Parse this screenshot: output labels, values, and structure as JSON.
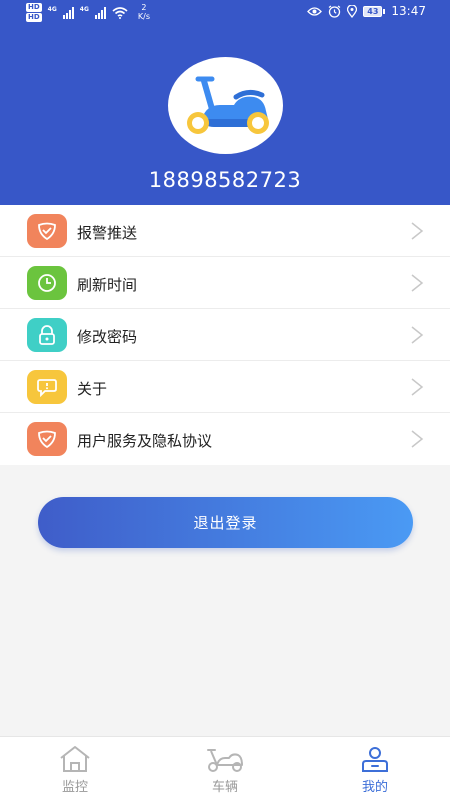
{
  "status_bar": {
    "hd1": "HD",
    "hd2": "HD",
    "net1": "4G",
    "net2": "4G",
    "speed_value": "2",
    "speed_unit": "K/s",
    "battery": "43",
    "time": "13:47"
  },
  "profile": {
    "phone": "18898582723"
  },
  "menu": {
    "items": [
      {
        "label": "报警推送",
        "color": "#f1845c",
        "icon": "shield-check-icon"
      },
      {
        "label": "刷新时间",
        "color": "#6bc43e",
        "icon": "clock-icon"
      },
      {
        "label": "修改密码",
        "color": "#3fcfc6",
        "icon": "lock-icon"
      },
      {
        "label": "关于",
        "color": "#f7c63c",
        "icon": "info-bubble-icon"
      },
      {
        "label": "用户服务及隐私协议",
        "color": "#f1845c",
        "icon": "shield-check-icon"
      }
    ]
  },
  "logout": {
    "label": "退出登录"
  },
  "tabbar": {
    "tabs": [
      {
        "label": "监控",
        "icon": "home-icon",
        "active": false
      },
      {
        "label": "车辆",
        "icon": "scooter-icon",
        "active": false
      },
      {
        "label": "我的",
        "icon": "user-icon",
        "active": true
      }
    ],
    "active_color": "#3d6fd8",
    "inactive_color": "#999999"
  },
  "colors": {
    "header": "#3757c8",
    "background": "#f4f4f4"
  }
}
